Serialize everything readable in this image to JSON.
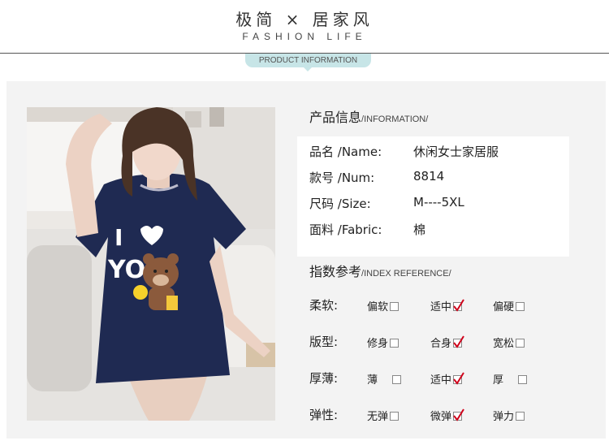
{
  "header": {
    "title": "极简 × 居家风",
    "subtitle": "FASHION LIFE",
    "badge": "PRODUCT INFORMATION"
  },
  "info": {
    "title_cn": "产品信息",
    "title_en": "/INFORMATION/",
    "rows": [
      {
        "label": "品名 /Name:",
        "value": "休闲女士家居服"
      },
      {
        "label": "款号 /Num:",
        "value": "8814"
      },
      {
        "label": "尺码 /Size:",
        "value": "M----5XL"
      },
      {
        "label": "面料 /Fabric:",
        "value": "棉"
      }
    ]
  },
  "reference": {
    "title_cn": "指数参考",
    "title_en": "/INDEX REFERENCE/",
    "rows": [
      {
        "label": "柔软:",
        "options": [
          {
            "text": "偏软",
            "checked": false
          },
          {
            "text": "适中",
            "checked": true
          },
          {
            "text": "偏硬",
            "checked": false
          }
        ]
      },
      {
        "label": "版型:",
        "options": [
          {
            "text": "修身",
            "checked": false
          },
          {
            "text": "合身",
            "checked": true
          },
          {
            "text": "宽松",
            "checked": false
          }
        ]
      },
      {
        "label": "厚薄:",
        "options": [
          {
            "text": "薄",
            "checked": false
          },
          {
            "text": "适中",
            "checked": true
          },
          {
            "text": "厚",
            "checked": false
          }
        ]
      },
      {
        "label": "弹性:",
        "options": [
          {
            "text": "无弹",
            "checked": false
          },
          {
            "text": "微弹",
            "checked": true
          },
          {
            "text": "弹力",
            "checked": false
          }
        ]
      }
    ]
  },
  "photo": {
    "shirt_text": "I ♥ YOU!"
  },
  "colors": {
    "badge_bg": "#c7e5e7",
    "panel_bg": "#f3f3f3",
    "check": "#d0021b",
    "shirt": "#1f2a52"
  }
}
